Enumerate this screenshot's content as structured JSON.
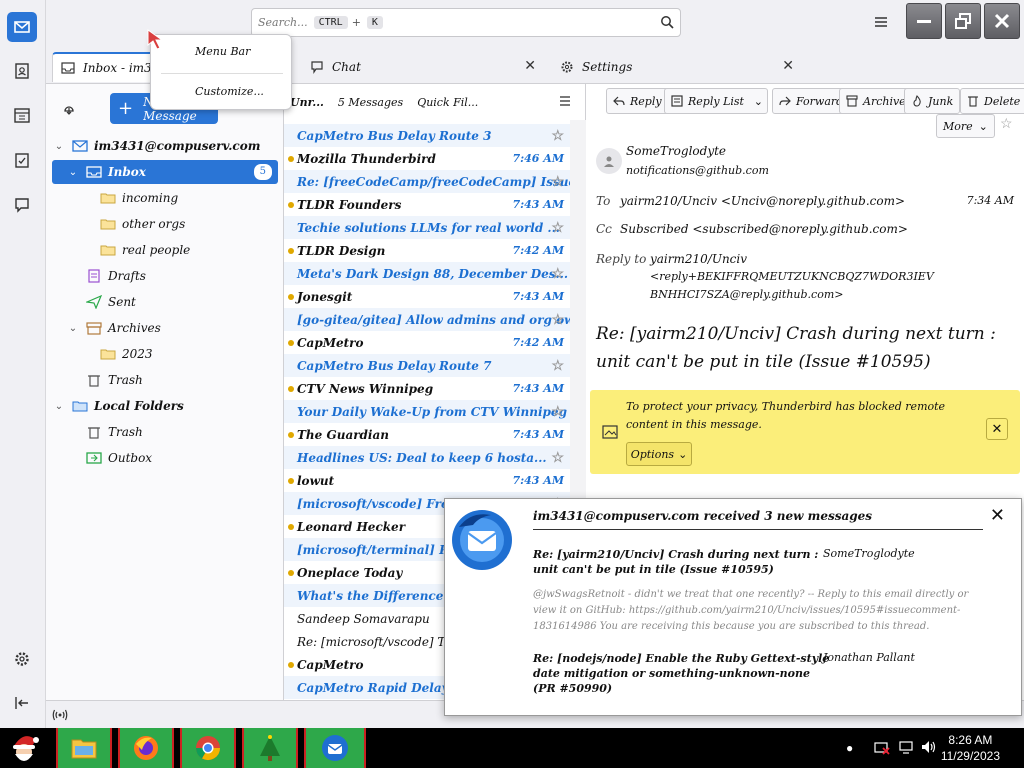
{
  "titlebar": {
    "search_placeholder": "Search...",
    "search_key1": "CTRL",
    "search_key2": "K"
  },
  "tabs": [
    {
      "label": "Inbox - im3431@..."
    },
    {
      "label": "Chat"
    },
    {
      "label": "Settings"
    }
  ],
  "context_menu": {
    "item1": "Menu Bar",
    "item2": "Customize..."
  },
  "folders": {
    "new_message": "New Message",
    "account": "im3431@compuserv.com",
    "inbox": "Inbox",
    "inbox_badge": "5",
    "sub1": "incoming",
    "sub2": "other orgs",
    "sub3": "real people",
    "drafts": "Drafts",
    "sent": "Sent",
    "archives": "Archives",
    "archive_year": "2023",
    "trash": "Trash",
    "local_folders": "Local Folders",
    "local_trash": "Trash",
    "outbox": "Outbox"
  },
  "thread_toolbar": {
    "filter_label": "Unr...",
    "messages_label": "5 Messages",
    "quick_filter": "Quick Fil..."
  },
  "threads": [
    {
      "text": "CapMetro Bus Delay Route 3",
      "type": "subj",
      "date": ""
    },
    {
      "text": "Mozilla Thunderbird",
      "type": "sender",
      "date": "7:46 AM"
    },
    {
      "text": "Re: [freeCodeCamp/freeCodeCamp] Issue: ...",
      "type": "subj",
      "date": ""
    },
    {
      "text": "TLDR Founders",
      "type": "sender",
      "date": "7:43 AM"
    },
    {
      "text": "Techie solutions LLMs for real world ...",
      "type": "subj",
      "date": ""
    },
    {
      "text": "TLDR Design",
      "type": "sender",
      "date": "7:42 AM"
    },
    {
      "text": "Meta's Dark Design 88, December Des...",
      "type": "subj",
      "date": ""
    },
    {
      "text": "Jonesgit",
      "type": "sender",
      "date": "7:43 AM"
    },
    {
      "text": "[go-gitea/gitea] Allow admins and org owners ...",
      "type": "subj",
      "date": ""
    },
    {
      "text": "CapMetro",
      "type": "sender",
      "date": "7:42 AM"
    },
    {
      "text": "CapMetro Bus Delay Route 7",
      "type": "subj",
      "date": ""
    },
    {
      "text": "CTV News Winnipeg",
      "type": "sender",
      "date": "7:43 AM"
    },
    {
      "text": "Your Daily Wake-Up from CTV Winnipeg",
      "type": "subj",
      "date": ""
    },
    {
      "text": "The Guardian",
      "type": "sender",
      "date": "7:43 AM"
    },
    {
      "text": "Headlines US: Deal to keep 6 hosta...",
      "type": "subj",
      "date": ""
    },
    {
      "text": "lowut",
      "type": "sender",
      "date": "7:43 AM"
    },
    {
      "text": "[microsoft/vscode] Frozen/tab...",
      "type": "subj",
      "date": ""
    },
    {
      "text": "Leonard Hecker",
      "type": "sender",
      "date": ""
    },
    {
      "text": "[microsoft/terminal] Remove ...",
      "type": "subj",
      "date": ""
    },
    {
      "text": "Oneplace Today",
      "type": "sender",
      "date": ""
    },
    {
      "text": "What's the Difference Betw...",
      "type": "subj",
      "date": ""
    },
    {
      "text": "Sandeep Somavarapu",
      "type": "plain",
      "date": ""
    },
    {
      "text": "Re: [microsoft/vscode] Ta...",
      "type": "plain",
      "date": ""
    },
    {
      "text": "CapMetro",
      "type": "sender",
      "date": ""
    },
    {
      "text": "CapMetro Rapid Delay ...",
      "type": "subj",
      "date": ""
    }
  ],
  "message": {
    "btn_reply": "Reply",
    "btn_reply_list": "Reply List",
    "btn_forward": "Forward",
    "btn_archive": "Archive",
    "btn_junk": "Junk",
    "btn_delete": "Delete",
    "btn_more": "More",
    "from_name": "SomeTroglodyte",
    "from_addr": "notifications@github.com",
    "to_label": "To",
    "to_value": "yairm210/Unciv <Unciv@noreply.github.com>",
    "to_time": "7:34 AM",
    "cc_label": "Cc",
    "cc_value": "Subscribed <subscribed@noreply.github.com>",
    "replyto_label": "Reply to",
    "replyto_line1": "yairm210/Unciv",
    "replyto_line2": "<reply+BEKIFFRQMEUTZUKNCBQZ7WDOR3IEV",
    "replyto_line3": "BNHHCI7SZA@reply.github.com>",
    "subject": "Re: [yairm210/Unciv] Crash during next turn : unit can't be put in tile (Issue #10595)",
    "privacy_text": "To protect your privacy, Thunderbird has blocked remote content in this message.",
    "options_btn": "Options"
  },
  "notification": {
    "title": "im3431@compuserv.com received 3 new messages",
    "msg1_subject": "Re: [yairm210/Unciv] Crash during next turn : unit can't be put in tile (Issue #10595)",
    "msg1_from": "SomeTroglodyte",
    "msg1_preview": "@jwSwagsRetnoit - didn't we treat that one recently? -- Reply to this email directly or view it on GitHub: https://github.com/yairm210/Unciv/issues/10595#issuecomment-1831614986 You are receiving this because you are subscribed to this thread.",
    "msg2_subject": "Re: [nodejs/node] Enable the Ruby Gettext-style date mitigation or something-unknown-none (PR #50990)",
    "msg2_from": "Jonathan Pallant"
  },
  "statusbar": {
    "icon": "wifi-radio-icon"
  },
  "taskbar": {
    "time": "8:26 AM",
    "date": "11/29/2023"
  },
  "colors": {
    "accent": "#2a75d6",
    "taskbar_green": "#2ea84a",
    "privacy_bg": "#fbee7a"
  }
}
